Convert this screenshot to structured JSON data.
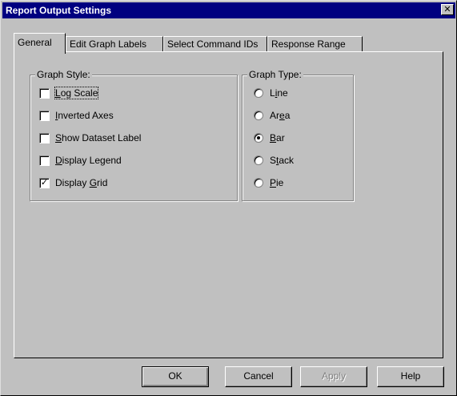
{
  "window": {
    "title": "Report Output Settings",
    "close_glyph": "✕"
  },
  "tabs": [
    {
      "label": "General",
      "active": true
    },
    {
      "label": "Edit Graph Labels",
      "active": false
    },
    {
      "label": "Select Command IDs",
      "active": false
    },
    {
      "label": "Response Range",
      "active": false
    }
  ],
  "graph_style": {
    "title": "Graph Style:",
    "options": [
      {
        "pre": "",
        "mn": "L",
        "post": "og Scale",
        "checked": false
      },
      {
        "pre": "",
        "mn": "I",
        "post": "nverted Axes",
        "checked": false
      },
      {
        "pre": "",
        "mn": "S",
        "post": "how Dataset Label",
        "checked": false
      },
      {
        "pre": "",
        "mn": "D",
        "post": "isplay Legend",
        "checked": false
      },
      {
        "pre": "Display ",
        "mn": "G",
        "post": "rid",
        "checked": true
      }
    ]
  },
  "graph_type": {
    "title": "Graph Type:",
    "options": [
      {
        "pre": "L",
        "mn": "i",
        "post": "ne",
        "selected": false
      },
      {
        "pre": "Ar",
        "mn": "e",
        "post": "a",
        "selected": false
      },
      {
        "pre": "",
        "mn": "B",
        "post": "ar",
        "selected": true
      },
      {
        "pre": "S",
        "mn": "t",
        "post": "ack",
        "selected": false
      },
      {
        "pre": "",
        "mn": "P",
        "post": "ie",
        "selected": false
      }
    ]
  },
  "buttons": {
    "ok": "OK",
    "cancel": "Cancel",
    "apply": "Apply",
    "help": "Help"
  },
  "checkmark_glyph": "✓"
}
